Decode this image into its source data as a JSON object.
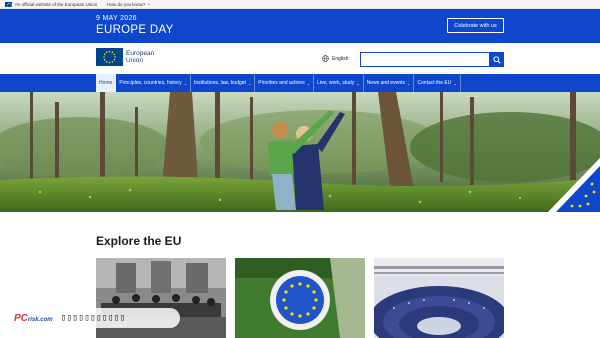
{
  "topbar": {
    "official_text": "An official website of the European Union",
    "how_text": "How do you know?"
  },
  "hero": {
    "date": "9 MAY 2026",
    "title": "EUROPE DAY",
    "celebrate_label": "Celebrate with us"
  },
  "header": {
    "logo_line1": "European",
    "logo_line2": "Union",
    "language": "English",
    "search_placeholder": ""
  },
  "nav": {
    "items": [
      {
        "label": "Home",
        "active": true,
        "dropdown": false
      },
      {
        "label": "Principles, countries, history",
        "dropdown": true
      },
      {
        "label": "Institutions, law, budget",
        "dropdown": true
      },
      {
        "label": "Priorities and actions",
        "dropdown": true
      },
      {
        "label": "Live, work, study",
        "dropdown": true
      },
      {
        "label": "News and events",
        "dropdown": true
      },
      {
        "label": "Contact the EU",
        "dropdown": true
      }
    ]
  },
  "main": {
    "section_title": "Explore the EU"
  },
  "watermark": {
    "logo_pc": "PC",
    "logo_risk": "risk.com",
    "text": "▯▯▯▯▯▯▯▯▯▯▯"
  },
  "colors": {
    "eu_blue": "#0e47cb",
    "eu_yellow": "#ffde00",
    "flag_blue": "#004494"
  },
  "icons": {
    "language": "globe-icon",
    "search": "search-icon",
    "dropdown": "chevron-down-icon"
  }
}
